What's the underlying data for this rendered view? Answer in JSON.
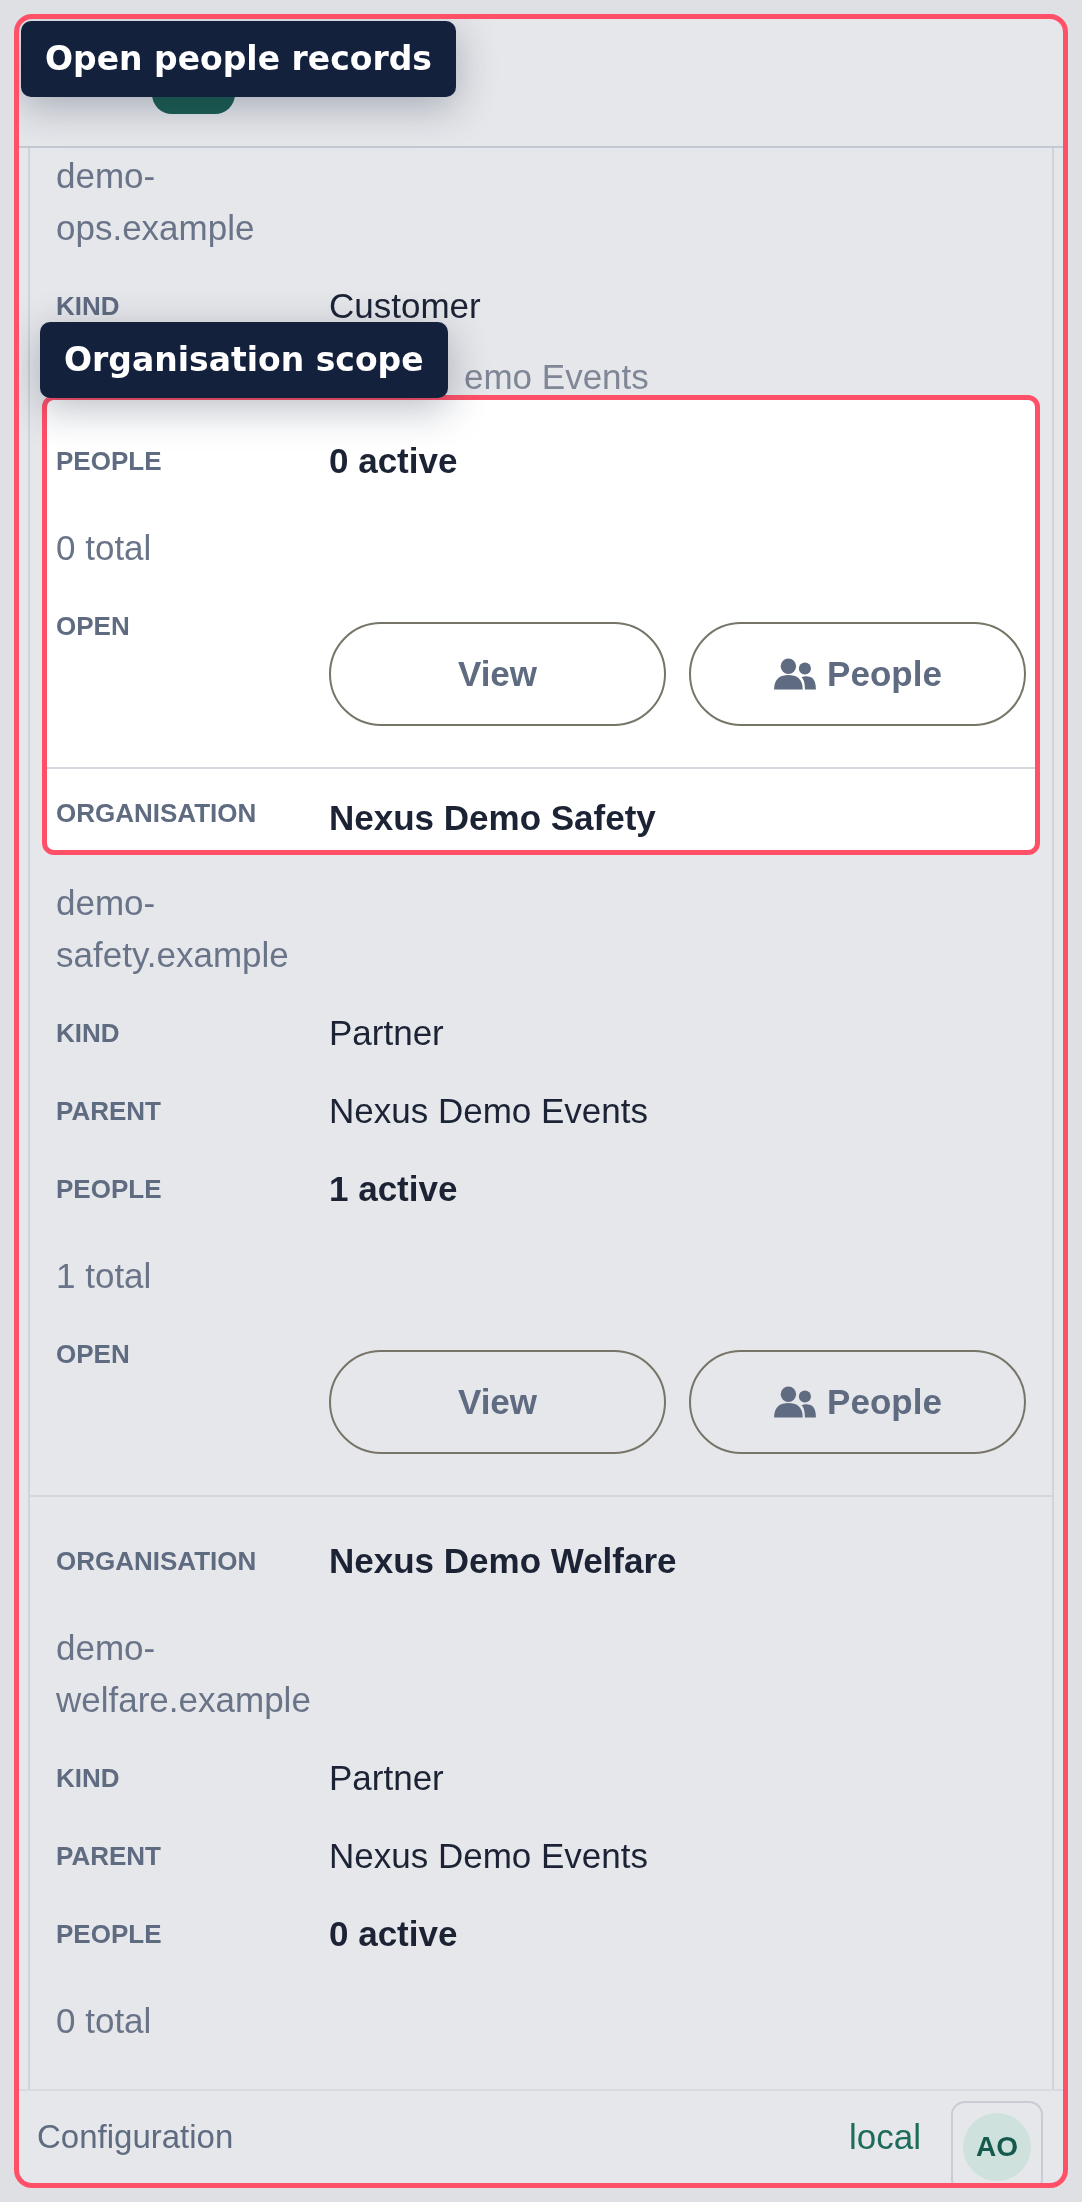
{
  "tooltips": [
    {
      "text": "Open people records"
    },
    {
      "text": "Organisation scope"
    }
  ],
  "records": [
    {
      "rows": [
        {
          "kind": "note",
          "text": "demo-ops.example",
          "spotlit": false
        },
        {
          "kind": "field",
          "label": "KIND",
          "value": "Customer",
          "strong": false,
          "spotlit": false
        },
        {
          "kind": "field",
          "value": "emo Events",
          "strong": false,
          "spotlit": false
        },
        {
          "kind": "field",
          "label": "PEOPLE",
          "value": "0 active",
          "strong": true,
          "spotlit": true
        },
        {
          "kind": "note",
          "text": "0 total",
          "spotlit": true
        },
        {
          "kind": "actions",
          "label": "OPEN",
          "buttons": [
            {
              "label": "View",
              "kind": "plain"
            },
            {
              "label": "People",
              "kind": "people"
            }
          ],
          "spotlit": true
        }
      ]
    },
    {
      "rows": [
        {
          "kind": "field",
          "label": "ORGANISATION",
          "value": "Nexus Demo Safety",
          "strong": true,
          "spotlit": true
        },
        {
          "kind": "note",
          "text": "demo-safety.example",
          "spotlit": false
        },
        {
          "kind": "field",
          "label": "KIND",
          "value": "Partner",
          "strong": false,
          "spotlit": false
        },
        {
          "kind": "field",
          "label": "PARENT",
          "value": "Nexus Demo Events",
          "strong": false,
          "spotlit": false
        },
        {
          "kind": "field",
          "label": "PEOPLE",
          "value": "1 active",
          "strong": true,
          "spotlit": false
        },
        {
          "kind": "note",
          "text": "1 total",
          "spotlit": false
        },
        {
          "kind": "actions",
          "label": "OPEN",
          "buttons": [
            {
              "label": "View",
              "kind": "plain"
            },
            {
              "label": "People",
              "kind": "people"
            }
          ],
          "spotlit": false
        }
      ]
    },
    {
      "rows": [
        {
          "kind": "field",
          "label": "ORGANISATION",
          "value": "Nexus Demo Welfare",
          "strong": true,
          "spotlit": false
        },
        {
          "kind": "note",
          "text": "demo-welfare.example",
          "spotlit": false
        },
        {
          "kind": "field",
          "label": "KIND",
          "value": "Partner",
          "strong": false,
          "spotlit": false
        },
        {
          "kind": "field",
          "label": "PARENT",
          "value": "Nexus Demo Events",
          "strong": false,
          "spotlit": false
        },
        {
          "kind": "field",
          "label": "PEOPLE",
          "value": "0 active",
          "strong": true,
          "spotlit": false
        },
        {
          "kind": "note",
          "text": "0 total",
          "spotlit": false
        }
      ]
    }
  ],
  "footer": {
    "title": "Configuration",
    "env": "local",
    "avatar": "AO"
  }
}
